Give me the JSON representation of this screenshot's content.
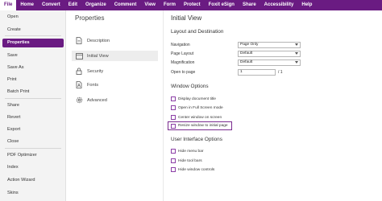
{
  "menu": [
    "File",
    "Home",
    "Convert",
    "Edit",
    "Organize",
    "Comment",
    "View",
    "Form",
    "Protect",
    "Foxit eSign",
    "Share",
    "Accessibility",
    "Help"
  ],
  "sidebar": {
    "items": [
      "Open",
      "Create",
      "Properties",
      "Save",
      "Save As",
      "Print",
      "Batch Print",
      "Share",
      "Revert",
      "Export",
      "Close",
      "PDF Optimizer",
      "Index",
      "Action Wizard",
      "Skins"
    ],
    "active": "Properties"
  },
  "properties": {
    "title": "Properties",
    "items": [
      {
        "label": "Description",
        "icon": "description-icon"
      },
      {
        "label": "Initial View",
        "icon": "initial-view-icon"
      },
      {
        "label": "Security",
        "icon": "lock-icon"
      },
      {
        "label": "Fonts",
        "icon": "fonts-icon"
      },
      {
        "label": "Advanced",
        "icon": "gear-icon"
      }
    ],
    "active": "Initial View"
  },
  "content": {
    "title": "Initial View",
    "layout_heading": "Layout and Destination",
    "navigation_label": "Navigation",
    "navigation_value": "Page Only",
    "page_layout_label": "Page Layout",
    "page_layout_value": "Default",
    "magnification_label": "Magnification",
    "magnification_value": "Default",
    "open_to_page_label": "Open to page",
    "open_to_page_value": "1",
    "open_to_page_total": "/ 1",
    "window_heading": "Window Options",
    "window_options": [
      "Display document title",
      "Open in Full Screen mode",
      "Center window on screen",
      "Resize window to initial page"
    ],
    "ui_heading": "User Interface Options",
    "ui_options": [
      "Hide menu bar",
      "Hide tool bars",
      "Hide window controls"
    ]
  },
  "colors": {
    "accent": "#6a1b82"
  }
}
